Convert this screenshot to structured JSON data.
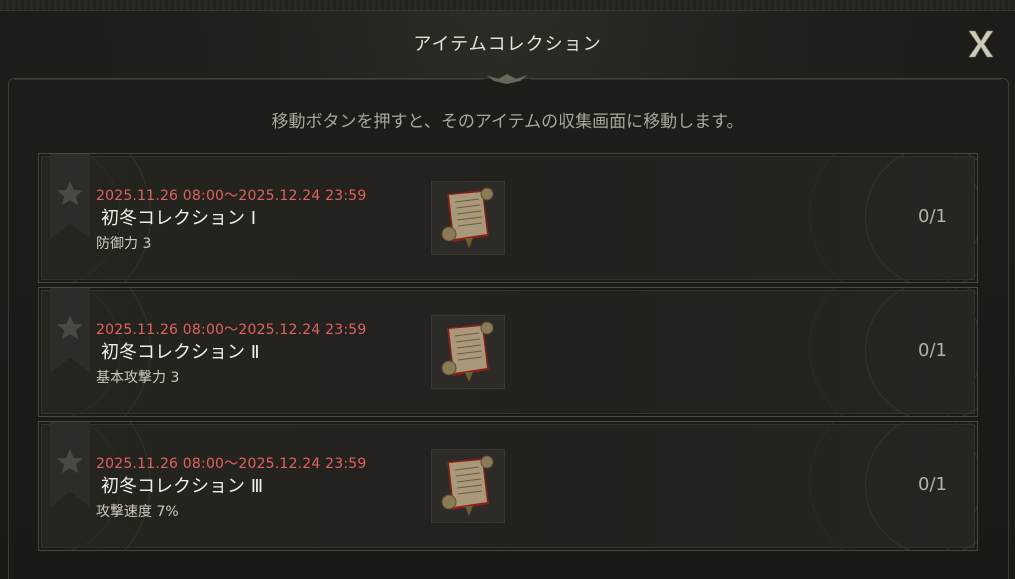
{
  "window": {
    "title": "アイテムコレクション",
    "close_label": "X"
  },
  "subtitle": "移動ボタンを押すと、そのアイテムの収集画面に移動します。",
  "collections": [
    {
      "period": "2025.11.26 08:00～2025.12.24 23:59",
      "name": "初冬コレクション Ⅰ",
      "effect": "防御力 3",
      "count": "0/1",
      "item_icon": "scroll-icon"
    },
    {
      "period": "2025.11.26 08:00～2025.12.24 23:59",
      "name": "初冬コレクション Ⅱ",
      "effect": "基本攻撃力 3",
      "count": "0/1",
      "item_icon": "scroll-icon"
    },
    {
      "period": "2025.11.26 08:00～2025.12.24 23:59",
      "name": "初冬コレクション Ⅲ",
      "effect": "攻撃速度 7%",
      "count": "0/1",
      "item_icon": "scroll-icon"
    }
  ],
  "colors": {
    "period_text": "#e0625f",
    "name_text": "#f2efe6",
    "background": "#1b1a17"
  }
}
